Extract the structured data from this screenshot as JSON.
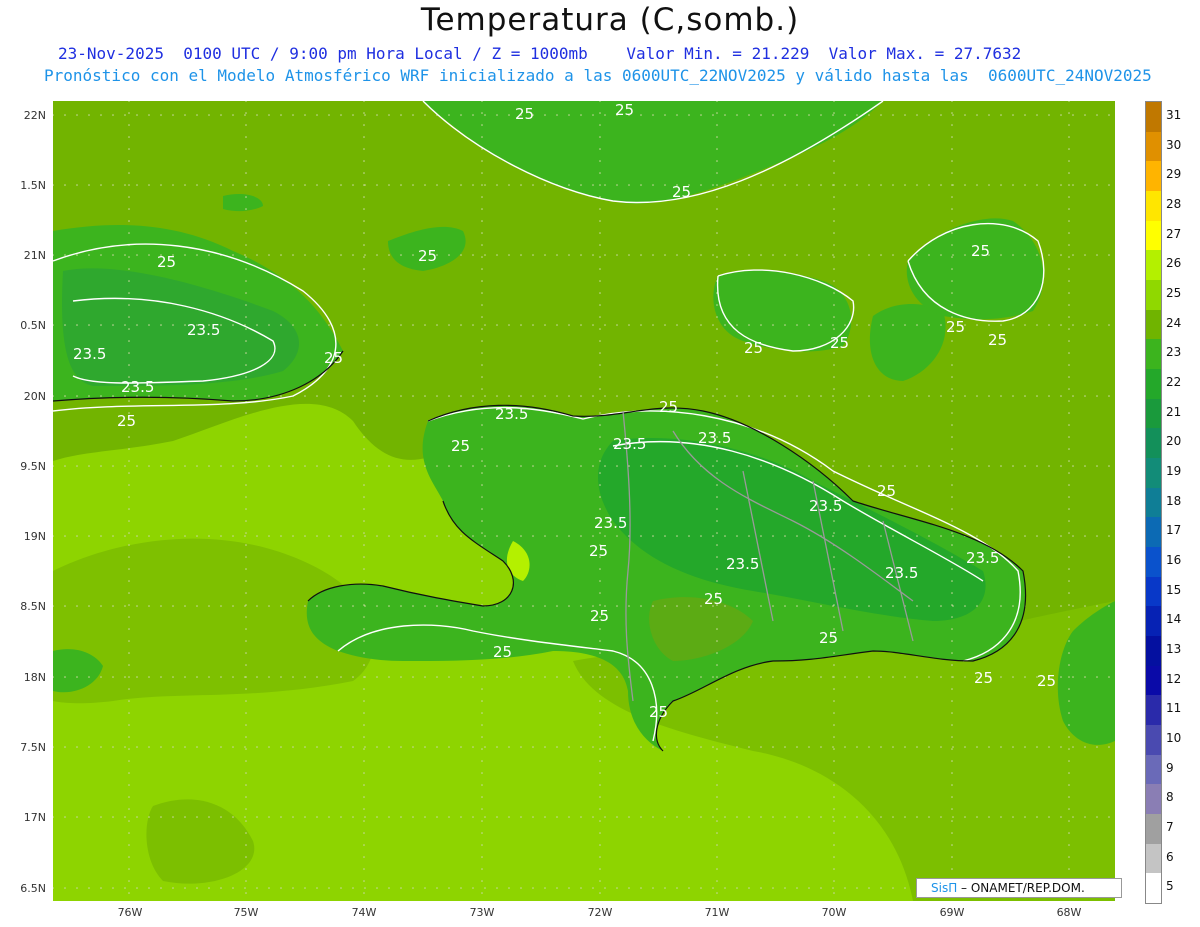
{
  "header": {
    "title": "Temperatura (C,somb.)",
    "subtitle_1": "23-Nov-2025  0100 UTC / 9:00 pm Hora Local / Z = 1000mb    Valor Min. = 21.229  Valor Max. = 27.7632",
    "subtitle_2": "Pronóstico con el Modelo Atmosférico WRF inicializado a las 0600UTC_22NOV2025 y válido hasta las  0600UTC_24NOV2025"
  },
  "axes": {
    "lat_labels": [
      "22N",
      "1.5N",
      "21N",
      "0.5N",
      "20N",
      "9.5N",
      "19N",
      "8.5N",
      "18N",
      "7.5N",
      "17N",
      "6.5N"
    ],
    "lon_labels": [
      "76W",
      "75W",
      "74W",
      "73W",
      "72W",
      "71W",
      "70W",
      "69W",
      "68W"
    ]
  },
  "contour_labels": [
    "25",
    "23.5"
  ],
  "colorbar": {
    "labels": [
      "31",
      "30",
      "29",
      "28",
      "27",
      "26",
      "25",
      "24",
      "23",
      "22",
      "21",
      "20",
      "19",
      "18",
      "17",
      "16",
      "15",
      "14",
      "13",
      "12",
      "11",
      "10",
      "9",
      "8",
      "7",
      "6",
      "5"
    ],
    "colors": [
      "#c07800",
      "#e09000",
      "#ffb400",
      "#ffe600",
      "#ffff00",
      "#b4f000",
      "#90d800",
      "#70b400",
      "#3cb41e",
      "#24a82a",
      "#1a9a3c",
      "#13905a",
      "#128c78",
      "#0f7e96",
      "#0c6ab4",
      "#0a52cc",
      "#0838c8",
      "#0622b4",
      "#0410a0",
      "#0a0aa8",
      "#2a2aaa",
      "#4a4ab0",
      "#6a6ab8",
      "#8a7eb4",
      "#a0a0a0",
      "#c4c4c4",
      "#ffffff"
    ]
  },
  "credit": {
    "brand": "SisΠ",
    "text": " – ONAMET/REP.DOM."
  }
}
